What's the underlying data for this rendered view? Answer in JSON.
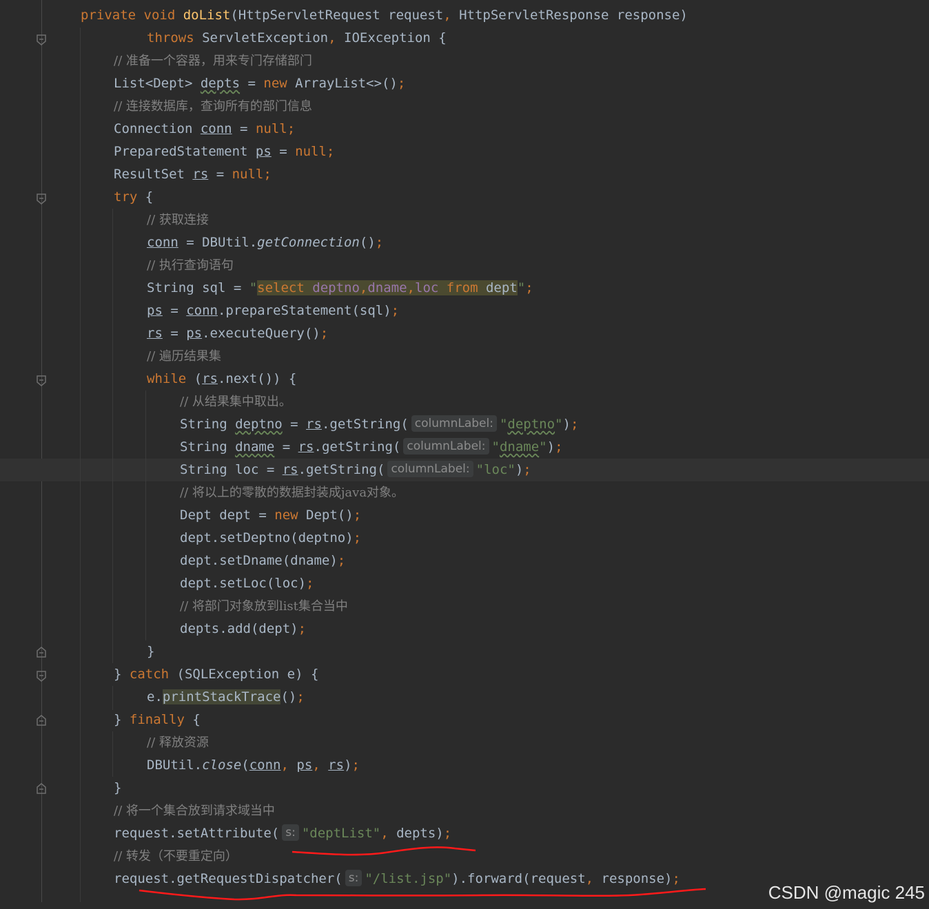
{
  "editor": {
    "lines": [
      {
        "id": "l1",
        "tokens": [
          [
            "kw",
            "private void "
          ],
          [
            "fn",
            "doList"
          ],
          [
            "",
            "(HttpServletRequest request"
          ],
          [
            "kw",
            ", "
          ],
          [
            "",
            "HttpServletResponse response)"
          ]
        ]
      },
      {
        "id": "l2",
        "tokens": [
          [
            "kw",
            "throws "
          ],
          [
            "",
            "ServletException"
          ],
          [
            "kw",
            ", "
          ],
          [
            "",
            "IOException {"
          ]
        ]
      },
      {
        "id": "l3",
        "tokens": [
          [
            "cm",
            "// 准备一个容器，用来专门存储部门"
          ]
        ]
      },
      {
        "id": "l4",
        "tokens": [
          [
            "",
            "List<Dept> "
          ],
          [
            "wavy",
            "depts"
          ],
          [
            "",
            " = "
          ],
          [
            "kw",
            "new "
          ],
          [
            "",
            "ArrayList<>()"
          ],
          [
            "kw",
            ";"
          ]
        ]
      },
      {
        "id": "l5",
        "tokens": [
          [
            "cm",
            "// 连接数据库，查询所有的部门信息"
          ]
        ]
      },
      {
        "id": "l6",
        "tokens": [
          [
            "",
            "Connection "
          ],
          [
            "ul",
            "conn"
          ],
          [
            "",
            " = "
          ],
          [
            "kw",
            "null;"
          ]
        ]
      },
      {
        "id": "l7",
        "tokens": [
          [
            "",
            "PreparedStatement "
          ],
          [
            "ul",
            "ps"
          ],
          [
            "",
            " = "
          ],
          [
            "kw",
            "null;"
          ]
        ]
      },
      {
        "id": "l8",
        "tokens": [
          [
            "",
            "ResultSet "
          ],
          [
            "ul",
            "rs"
          ],
          [
            "",
            " = "
          ],
          [
            "kw",
            "null;"
          ]
        ]
      },
      {
        "id": "l9",
        "tokens": [
          [
            "kw",
            "try "
          ],
          [
            "",
            "{"
          ]
        ]
      },
      {
        "id": "l10",
        "tokens": [
          [
            "cm",
            "// 获取连接"
          ]
        ]
      },
      {
        "id": "l11",
        "tokens": [
          [
            "ul",
            "conn"
          ],
          [
            "",
            " = DBUtil."
          ],
          [
            "it",
            "getConnection"
          ],
          [
            "",
            "()"
          ],
          [
            "kw",
            ";"
          ]
        ]
      },
      {
        "id": "l12",
        "tokens": [
          [
            "cm",
            "// 执行查询语句"
          ]
        ]
      },
      {
        "id": "l13",
        "tokens": [
          [
            "",
            "String sql = "
          ],
          [
            "str",
            "\""
          ],
          [
            "sqlkw",
            "select "
          ],
          [
            "sqlid",
            "deptno"
          ],
          [
            "sqlkw",
            ","
          ],
          [
            "sqlid",
            "dname"
          ],
          [
            "sqlkw",
            ","
          ],
          [
            "sqlid",
            "loc "
          ],
          [
            "sqlfrom",
            "from "
          ],
          [
            "sqlplain",
            "dept"
          ],
          [
            "str",
            "\""
          ],
          [
            "kw",
            ";"
          ]
        ]
      },
      {
        "id": "l14",
        "tokens": [
          [
            "ul",
            "ps"
          ],
          [
            "",
            " = "
          ],
          [
            "ul",
            "conn"
          ],
          [
            "",
            ".prepareStatement(sql)"
          ],
          [
            "kw",
            ";"
          ]
        ]
      },
      {
        "id": "l15",
        "tokens": [
          [
            "ul",
            "rs"
          ],
          [
            "",
            " = "
          ],
          [
            "ul",
            "ps"
          ],
          [
            "",
            ".executeQuery()"
          ],
          [
            "kw",
            ";"
          ]
        ]
      },
      {
        "id": "l16",
        "tokens": [
          [
            "cm",
            "// 遍历结果集"
          ]
        ]
      },
      {
        "id": "l17",
        "tokens": [
          [
            "kw",
            "while "
          ],
          [
            "",
            "("
          ],
          [
            "ul",
            "rs"
          ],
          [
            "",
            ".next()) {"
          ]
        ]
      },
      {
        "id": "l18",
        "tokens": [
          [
            "cm",
            "// 从结果集中取出。"
          ]
        ]
      },
      {
        "id": "l19",
        "tokens": [
          [
            "",
            "String "
          ],
          [
            "wavy",
            "deptno"
          ],
          [
            "",
            " = "
          ],
          [
            "ul",
            "rs"
          ],
          [
            "",
            ".getString("
          ],
          [
            "hint",
            "columnLabel:"
          ],
          [
            "str",
            "\""
          ],
          [
            "wavystr",
            "deptno"
          ],
          [
            "str",
            "\""
          ],
          [
            "",
            ")"
          ],
          [
            "kw",
            ";"
          ]
        ]
      },
      {
        "id": "l20",
        "tokens": [
          [
            "",
            "String "
          ],
          [
            "wavy",
            "dname"
          ],
          [
            "",
            " = "
          ],
          [
            "ul",
            "rs"
          ],
          [
            "",
            ".getString("
          ],
          [
            "hint",
            "columnLabel:"
          ],
          [
            "str",
            "\""
          ],
          [
            "wavystr",
            "dname"
          ],
          [
            "str",
            "\""
          ],
          [
            "",
            ")"
          ],
          [
            "kw",
            ";"
          ]
        ]
      },
      {
        "id": "l21",
        "tokens": [
          [
            "",
            "String loc = "
          ],
          [
            "ul",
            "rs"
          ],
          [
            "",
            ".getString("
          ],
          [
            "hint",
            "columnLabel:"
          ],
          [
            "str",
            "\"loc\""
          ],
          [
            "",
            ")"
          ],
          [
            "kw",
            ";"
          ]
        ]
      },
      {
        "id": "l22",
        "tokens": [
          [
            "cm",
            "// 将以上的零散的数据封装成java对象。"
          ]
        ]
      },
      {
        "id": "l23",
        "tokens": [
          [
            "",
            "Dept dept = "
          ],
          [
            "kw",
            "new "
          ],
          [
            "",
            "Dept()"
          ],
          [
            "kw",
            ";"
          ]
        ]
      },
      {
        "id": "l24",
        "tokens": [
          [
            "",
            "dept.setDeptno(deptno)"
          ],
          [
            "kw",
            ";"
          ]
        ]
      },
      {
        "id": "l25",
        "tokens": [
          [
            "",
            "dept.setDname(dname)"
          ],
          [
            "kw",
            ";"
          ]
        ]
      },
      {
        "id": "l26",
        "tokens": [
          [
            "",
            "dept.setLoc(loc)"
          ],
          [
            "kw",
            ";"
          ]
        ]
      },
      {
        "id": "l27",
        "tokens": [
          [
            "cm",
            "// 将部门对象放到list集合当中"
          ]
        ]
      },
      {
        "id": "l28",
        "tokens": [
          [
            "",
            "depts.add(dept)"
          ],
          [
            "kw",
            ";"
          ]
        ]
      },
      {
        "id": "l29",
        "tokens": [
          [
            "",
            "}"
          ]
        ]
      },
      {
        "id": "l30",
        "tokens": [
          [
            "",
            "} "
          ],
          [
            "kw",
            "catch "
          ],
          [
            "",
            "(SQLException e) {"
          ]
        ]
      },
      {
        "id": "l31",
        "tokens": [
          [
            "",
            "e."
          ],
          [
            "hl",
            "printStackTrace"
          ],
          [
            "",
            "()"
          ],
          [
            "kw",
            ";"
          ]
        ]
      },
      {
        "id": "l32",
        "tokens": [
          [
            "",
            "} "
          ],
          [
            "kw",
            "finally "
          ],
          [
            "",
            "{"
          ]
        ]
      },
      {
        "id": "l33",
        "tokens": [
          [
            "cm",
            "// 释放资源"
          ]
        ]
      },
      {
        "id": "l34",
        "tokens": [
          [
            "",
            "DBUtil."
          ],
          [
            "it",
            "close"
          ],
          [
            "",
            "("
          ],
          [
            "ul",
            "conn"
          ],
          [
            "kw",
            ", "
          ],
          [
            "ul",
            "ps"
          ],
          [
            "kw",
            ", "
          ],
          [
            "ul",
            "rs"
          ],
          [
            "",
            ")"
          ],
          [
            "kw",
            ";"
          ]
        ]
      },
      {
        "id": "l35",
        "tokens": [
          [
            "",
            "}"
          ]
        ]
      },
      {
        "id": "l36",
        "tokens": [
          [
            "cm",
            "// 将一个集合放到请求域当中"
          ]
        ]
      },
      {
        "id": "l37",
        "tokens": [
          [
            "",
            "request.setAttribute("
          ],
          [
            "hint",
            "s:"
          ],
          [
            "str",
            "\"deptList\""
          ],
          [
            "kw",
            ", "
          ],
          [
            "",
            "depts)"
          ],
          [
            "kw",
            ";"
          ]
        ]
      },
      {
        "id": "l38",
        "tokens": [
          [
            "cm",
            "// 转发（不要重定向）"
          ]
        ]
      },
      {
        "id": "l39",
        "tokens": [
          [
            "",
            "request.getRequestDispatcher("
          ],
          [
            "hint",
            "s:"
          ],
          [
            "str",
            "\"/list.jsp\""
          ],
          [
            "",
            ").forward(request"
          ],
          [
            "kw",
            ", "
          ],
          [
            "",
            "response)"
          ],
          [
            "kw",
            ";"
          ]
        ]
      }
    ]
  },
  "watermark": "CSDN @magic 245",
  "colors": {
    "background": "#2b2b2b",
    "keyword": "#cc7832",
    "function": "#ffc66d",
    "string": "#6a8759",
    "comment": "#808080",
    "text": "#a9b7c6",
    "annotation_red": "#ff0000"
  }
}
